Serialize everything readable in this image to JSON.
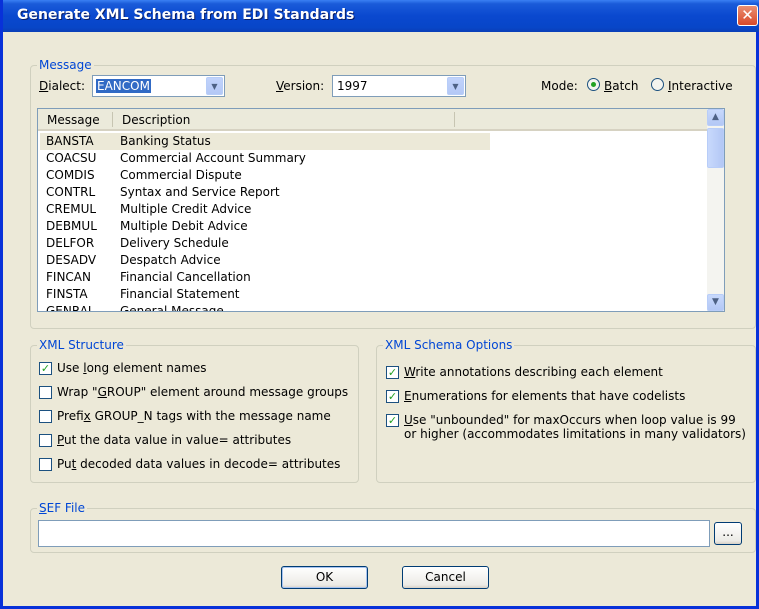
{
  "window": {
    "title": "Generate XML Schema from EDI Standards",
    "close_glyph": "✕"
  },
  "message_group": {
    "label": "Message",
    "dialect_label_u": "D",
    "dialect_label_rest": "ialect:",
    "dialect_value": "EANCOM",
    "version_label_u": "V",
    "version_label_rest": "ersion:",
    "version_value": "1997",
    "mode_label": "Mode:",
    "mode_batch_u": "B",
    "mode_batch_rest": "atch",
    "mode_interactive_u": "I",
    "mode_interactive_rest": "nteractive",
    "mode_selected": "Batch",
    "list": {
      "col_message": "Message",
      "col_description": "Description",
      "rows": [
        {
          "code": "BANSTA",
          "desc": "Banking Status"
        },
        {
          "code": "COACSU",
          "desc": "Commercial Account Summary"
        },
        {
          "code": "COMDIS",
          "desc": "Commercial Dispute"
        },
        {
          "code": "CONTRL",
          "desc": "Syntax and Service Report"
        },
        {
          "code": "CREMUL",
          "desc": "Multiple Credit Advice"
        },
        {
          "code": "DEBMUL",
          "desc": "Multiple Debit Advice"
        },
        {
          "code": "DELFOR",
          "desc": "Delivery Schedule"
        },
        {
          "code": "DESADV",
          "desc": "Despatch Advice"
        },
        {
          "code": "FINCAN",
          "desc": "Financial Cancellation"
        },
        {
          "code": "FINSTA",
          "desc": "Financial Statement"
        },
        {
          "code": "GENRAL",
          "desc": "General Message"
        }
      ],
      "selected_row": "BANSTA"
    }
  },
  "xml_structure": {
    "label": "XML Structure",
    "options": [
      {
        "pre": "Use ",
        "u": "l",
        "post": "ong element names",
        "checked": true
      },
      {
        "pre": "Wrap \"",
        "u": "G",
        "post": "ROUP\" element around message groups",
        "checked": false
      },
      {
        "pre": "Prefi",
        "u": "x",
        "post": " GROUP_N tags with the message name",
        "checked": false
      },
      {
        "pre": "",
        "u": "P",
        "post": "ut the data value in value= attributes",
        "checked": false
      },
      {
        "pre": "Pu",
        "u": "t",
        "post": " decoded data values in decode= attributes",
        "checked": false
      }
    ]
  },
  "schema_options": {
    "label": "XML Schema Options",
    "options": [
      {
        "pre": "",
        "u": "W",
        "post": "rite annotations describing each element",
        "checked": true
      },
      {
        "pre": "",
        "u": "E",
        "post": "numerations for elements that have codelists",
        "checked": true
      },
      {
        "pre": "",
        "u": "U",
        "post": "se \"unbounded\" for maxOccurs when loop value is 99",
        "line2": "or higher (accommodates limitations in many validators)",
        "checked": true
      }
    ]
  },
  "sef_file": {
    "label_u": "S",
    "label_rest": "EF File",
    "value": "",
    "browse_label": "..."
  },
  "buttons": {
    "ok": "OK",
    "cancel": "Cancel"
  },
  "icons": {
    "close": "close-icon",
    "dropdown": "chevron-down-icon",
    "check": "checkmark-icon"
  },
  "colors": {
    "titlebar": "#0a48cf",
    "group_label": "#0046d5",
    "check": "#21a121"
  }
}
